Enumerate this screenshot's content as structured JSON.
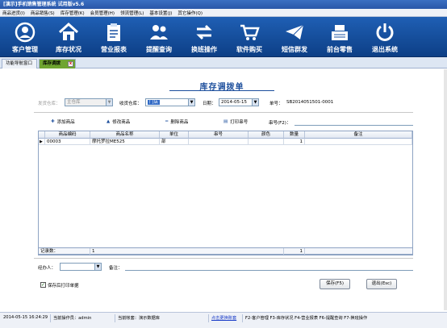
{
  "window": {
    "title": "[演示]手机销售管理系统  试用版v5.6"
  },
  "menu": [
    "商品进货(I)",
    "商品销售(S)",
    "库存管理(K)",
    "会员管理(H)",
    "领流管理(L)",
    "基本设置(J)",
    "其它操作(Q)"
  ],
  "toolbar": [
    {
      "label": "客户管理",
      "icon": "customer-icon"
    },
    {
      "label": "库存状况",
      "icon": "home-icon"
    },
    {
      "label": "营业报表",
      "icon": "clipboard-icon"
    },
    {
      "label": "提醒查询",
      "icon": "users-icon"
    },
    {
      "label": "换班操作",
      "icon": "swap-icon"
    },
    {
      "label": "软件购买",
      "icon": "cart-icon"
    },
    {
      "label": "短信群发",
      "icon": "mail-icon"
    },
    {
      "label": "前台零售",
      "icon": "register-icon"
    },
    {
      "label": "退出系统",
      "icon": "power-icon"
    }
  ],
  "tabs": {
    "nav": "功能导航窗口",
    "active": "库存调拨",
    "close": "x"
  },
  "form": {
    "title": "库存调拨单",
    "send_label": "发货仓库：",
    "send_value": "主仓库",
    "recv_label": "收货仓库：",
    "recv_value": "门店",
    "date_label": "日期：",
    "date_value": "2014-05-15",
    "no_label": "单号：",
    "no_value": "SB2014051501-0001"
  },
  "actions": {
    "add": "添加商品",
    "edit": "修改商品",
    "del": "删除商品",
    "print": "打印串号",
    "serial_label": "串号(F2)："
  },
  "grid": {
    "headers": [
      "商品编码",
      "商品名称",
      "单位",
      "串号",
      "颜色",
      "数量",
      "备注"
    ],
    "rows": [
      {
        "marker": "▶",
        "code": "00003",
        "name": "摩托罗拉ME525",
        "unit": "部",
        "serial": "",
        "color": "",
        "qty": "1",
        "note": ""
      }
    ],
    "footer": {
      "label": "记录数：",
      "count": "1",
      "total": "1"
    }
  },
  "bottom": {
    "handler_label": "经办人：",
    "note_label": "备注：",
    "print_after": "保存后打印单据",
    "save": "保存(F5)",
    "exit": "退出(Esc)"
  },
  "status": {
    "datetime": "2014-05-15 16:24:29",
    "operator": "当前操作员：admin",
    "account": "当前帐套：演示数据库",
    "link": "点击更换账套",
    "hotkeys": "F2-客户管理 F3-库存状况 F4-营业报表 F6-提醒查询 F7-换班操作"
  },
  "colors": {
    "accent": "#1c4e9c",
    "toolbar": "#1a52a3",
    "active_tab": "#6fa531",
    "link": "#1a3cc8"
  }
}
